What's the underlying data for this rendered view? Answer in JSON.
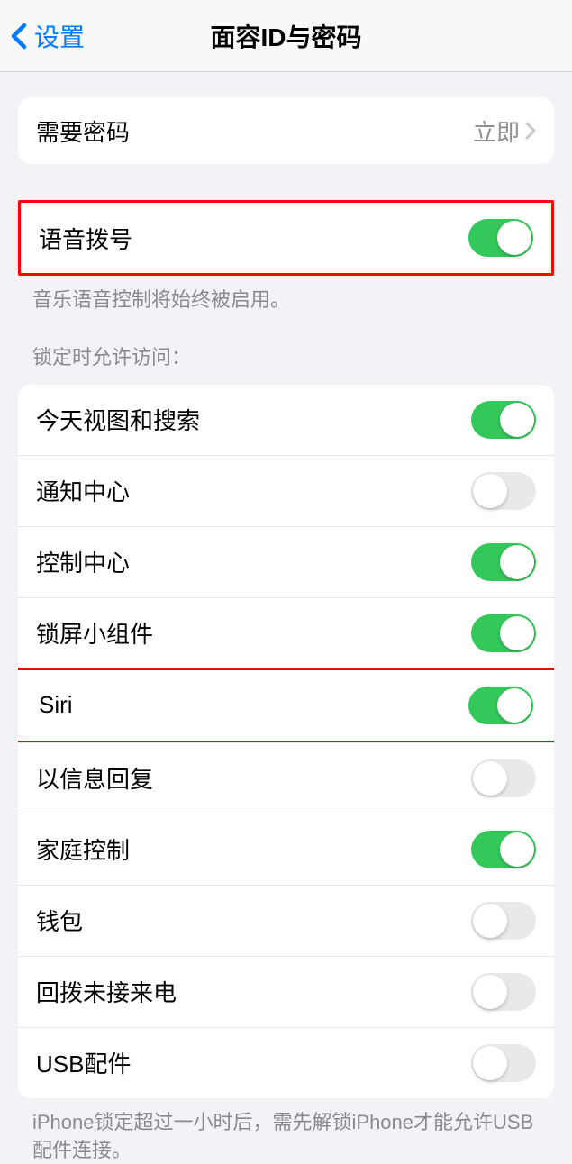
{
  "header": {
    "back_label": "设置",
    "title": "面容ID与密码"
  },
  "require_passcode": {
    "label": "需要密码",
    "value": "立即"
  },
  "voice_dial": {
    "label": "语音拨号",
    "on": true,
    "footer": "音乐语音控制将始终被启用。"
  },
  "lock_access_header": "锁定时允许访问：",
  "lock_access": [
    {
      "label": "今天视图和搜索",
      "on": true,
      "highlight": false
    },
    {
      "label": "通知中心",
      "on": false,
      "highlight": false
    },
    {
      "label": "控制中心",
      "on": true,
      "highlight": false
    },
    {
      "label": "锁屏小组件",
      "on": true,
      "highlight": false
    },
    {
      "label": "Siri",
      "on": true,
      "highlight": true
    },
    {
      "label": "以信息回复",
      "on": false,
      "highlight": false
    },
    {
      "label": "家庭控制",
      "on": true,
      "highlight": false
    },
    {
      "label": "钱包",
      "on": false,
      "highlight": false
    },
    {
      "label": "回拨未接来电",
      "on": false,
      "highlight": false
    },
    {
      "label": "USB配件",
      "on": false,
      "highlight": false
    }
  ],
  "usb_footer": "iPhone锁定超过一小时后，需先解锁iPhone才能允许USB配件连接。"
}
